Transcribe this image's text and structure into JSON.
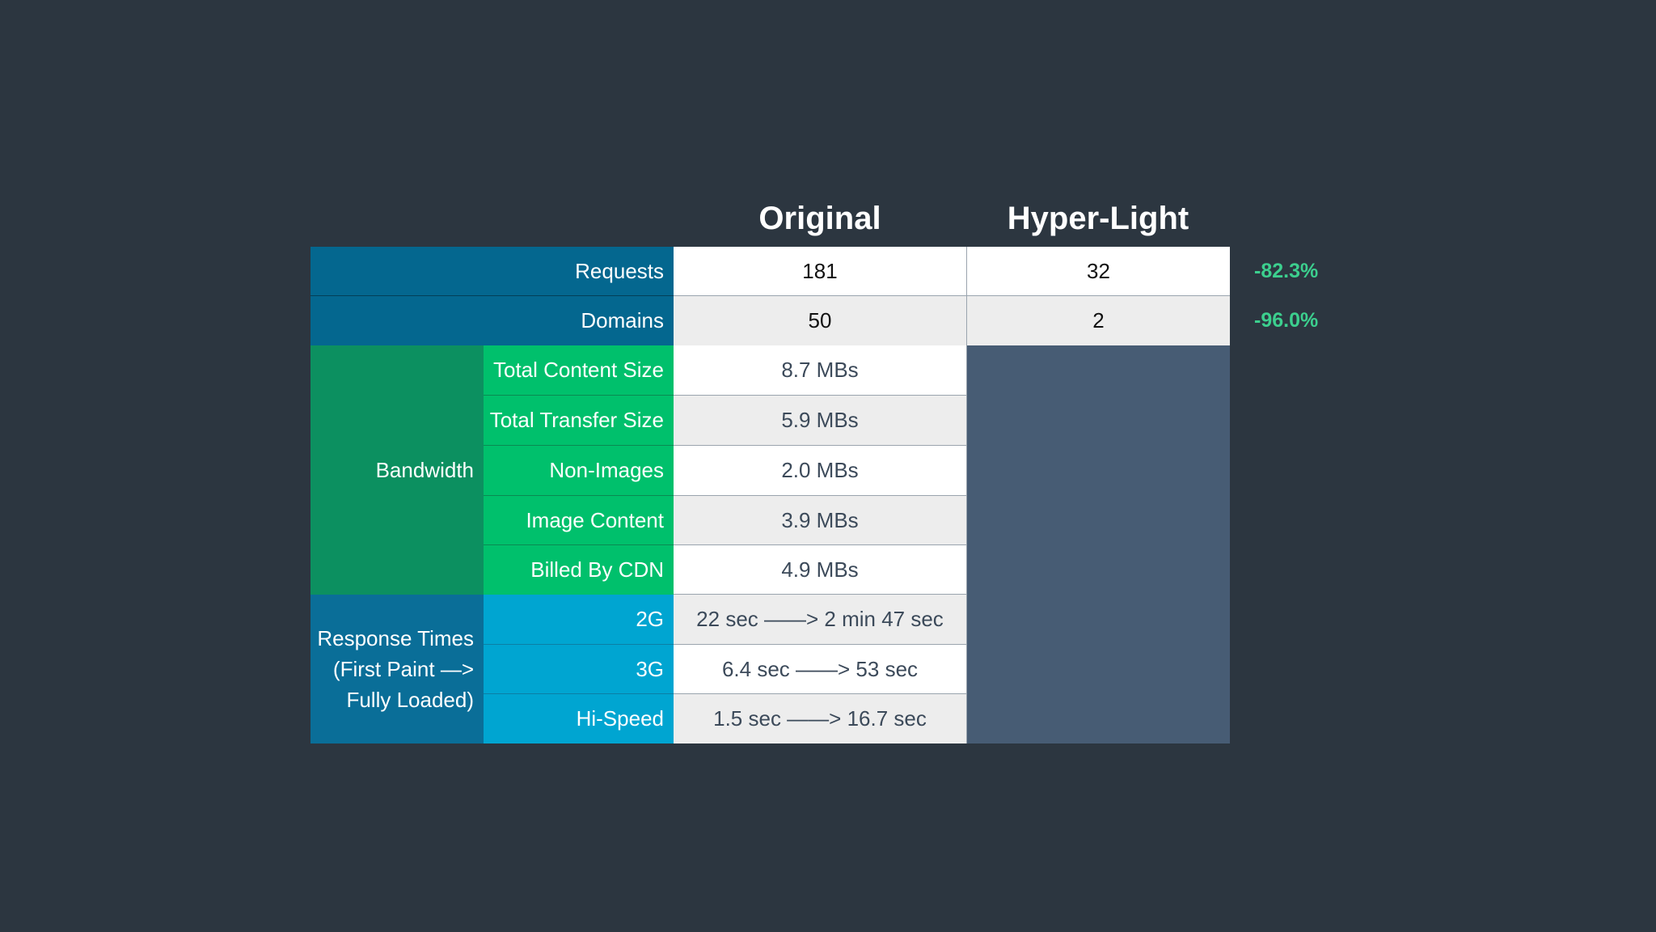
{
  "columns": {
    "original": "Original",
    "hyper_light": "Hyper-Light"
  },
  "rows": {
    "requests": {
      "label": "Requests",
      "original": "181",
      "hyper_light": "32",
      "change": "-82.3%"
    },
    "domains": {
      "label": "Domains",
      "original": "50",
      "hyper_light": "2",
      "change": "-96.0%"
    }
  },
  "bandwidth": {
    "group_label": "Bandwidth",
    "items": [
      {
        "label": "Total Content Size",
        "original": "8.7 MBs"
      },
      {
        "label": "Total Transfer Size",
        "original": "5.9 MBs"
      },
      {
        "label": "Non-Images",
        "original": "2.0 MBs"
      },
      {
        "label": "Image Content",
        "original": "3.9 MBs"
      },
      {
        "label": "Billed By CDN",
        "original": "4.9 MBs"
      }
    ]
  },
  "response_times": {
    "group_label_lines": [
      "Response Times",
      "(First Paint —>",
      "Fully Loaded)"
    ],
    "items": [
      {
        "label": "2G",
        "original": "22 sec ——> 2 min 47 sec"
      },
      {
        "label": "3G",
        "original": "6.4 sec ——> 53 sec"
      },
      {
        "label": "Hi-Speed",
        "original": "1.5 sec ——> 16.7 sec"
      }
    ]
  },
  "colors": {
    "background": "#2c3640",
    "top_label_fill": "#04678f",
    "bandwidth_group_fill": "#0c9060",
    "bandwidth_item_fill": "#00c06c",
    "response_group_fill": "#0a6e98",
    "response_item_fill": "#00a5d1",
    "hyper_light_empty_fill": "#475c74",
    "change_text": "#3ccf8e"
  }
}
